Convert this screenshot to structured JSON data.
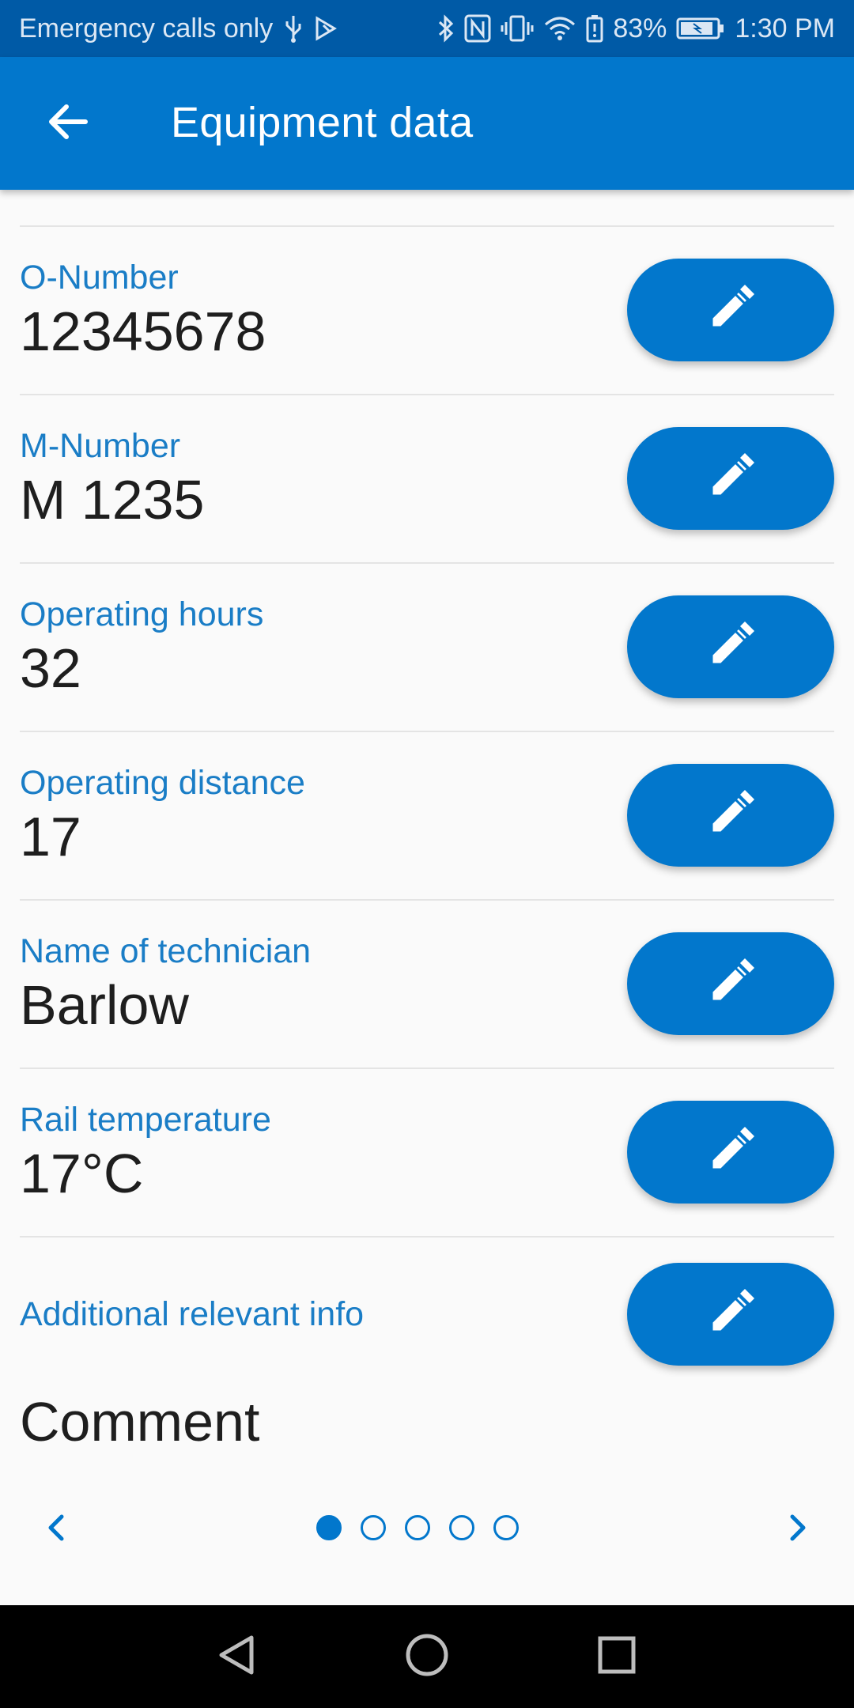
{
  "status_bar": {
    "carrier": "Emergency calls only",
    "battery": "83%",
    "time": "1:30 PM",
    "icons": [
      "usb-icon",
      "play-store-icon",
      "bluetooth-icon",
      "nfc-icon",
      "vibrate-icon",
      "wifi-icon",
      "battery-alert-icon",
      "battery-icon"
    ]
  },
  "app_bar": {
    "title": "Equipment data",
    "back_icon": "arrow-back-icon"
  },
  "fields": [
    {
      "label": "O-Number",
      "value": "12345678"
    },
    {
      "label": "M-Number",
      "value": "M 1235"
    },
    {
      "label": "Operating hours",
      "value": "32"
    },
    {
      "label": "Operating distance",
      "value": "17"
    },
    {
      "label": "Name of technician",
      "value": "Barlow"
    },
    {
      "label": "Rail temperature",
      "value": "17°C"
    }
  ],
  "additional": {
    "label": "Additional relevant info",
    "value": "Comment"
  },
  "pager": {
    "total_pages": 5,
    "current_page": 1
  },
  "colors": {
    "primary": "#0277cc",
    "status_bar": "#005aa6",
    "label": "#1a7dc6",
    "text": "#1e1e1e",
    "background": "#fafafa"
  }
}
